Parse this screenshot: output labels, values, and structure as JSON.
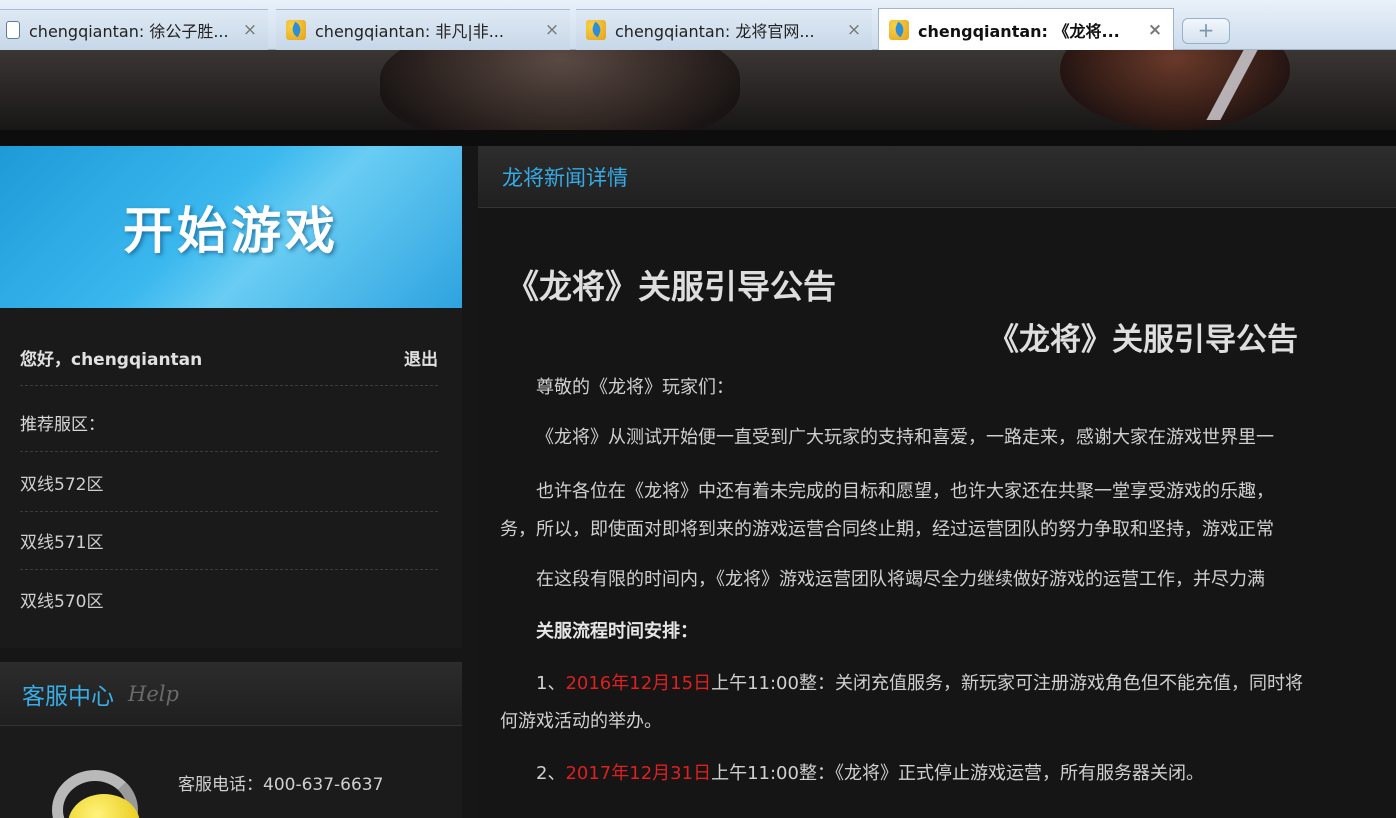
{
  "browser": {
    "tabs": [
      {
        "label": "chengqiantan: 徐公子胜...",
        "active": false,
        "icon": "document-icon"
      },
      {
        "label": "chengqiantan: 非凡|非...",
        "active": false,
        "icon": "app-icon"
      },
      {
        "label": "chengqiantan: 龙将官网...",
        "active": false,
        "icon": "app-icon"
      },
      {
        "label": "chengqiantan: 《龙将...",
        "active": true,
        "icon": "app-icon"
      }
    ],
    "close_glyph": "×",
    "new_tab_glyph": "+"
  },
  "sidebar": {
    "start_game": "开始游戏",
    "greeting": "您好，chengqiantan",
    "logout": "退出",
    "recommended_label": "推荐服区：",
    "servers": [
      "双线572区",
      "双线571区",
      "双线570区"
    ],
    "service": {
      "title": "客服中心",
      "subtitle": "Help",
      "phone": "客服电话：400-637-6637"
    }
  },
  "main": {
    "section_title": "龙将新闻详情",
    "article_title": "《龙将》关服引导公告",
    "article_subtitle": "《龙将》关服引导公告",
    "salutation": "尊敬的《龙将》玩家们：",
    "p1": "《龙将》从测试开始便一直受到广大玩家的支持和喜爱，一路走来，感谢大家在游戏世界里一",
    "p2a": "也许各位在《龙将》中还有着未完成的目标和愿望，也许大家还在共聚一堂享受游戏的乐趣，",
    "p2b": "务，所以，即使面对即将到来的游戏运营合同终止期，经过运营团队的努力争取和坚持，游戏正常",
    "p3": "在这段有限的时间内，《龙将》游戏运营团队将竭尽全力继续做好游戏的运营工作，并尽力满",
    "schedule_heading": "关服流程时间安排：",
    "item1_prefix": "1、",
    "item1_date": "2016年12月15日",
    "item1_text": "上午11:00整：关闭充值服务，新玩家可注册游戏角色但不能充值，同时将",
    "item1_cont": "何游戏活动的举办。",
    "item2_prefix": "2、",
    "item2_date": "2017年12月31日",
    "item2_text": "上午11:00整：《龙将》正式停止游戏运营，所有服务器关闭。"
  },
  "colors": {
    "accent_blue": "#35aae4",
    "date_red": "#e01f1f",
    "start_button": "#3bb8ee"
  }
}
